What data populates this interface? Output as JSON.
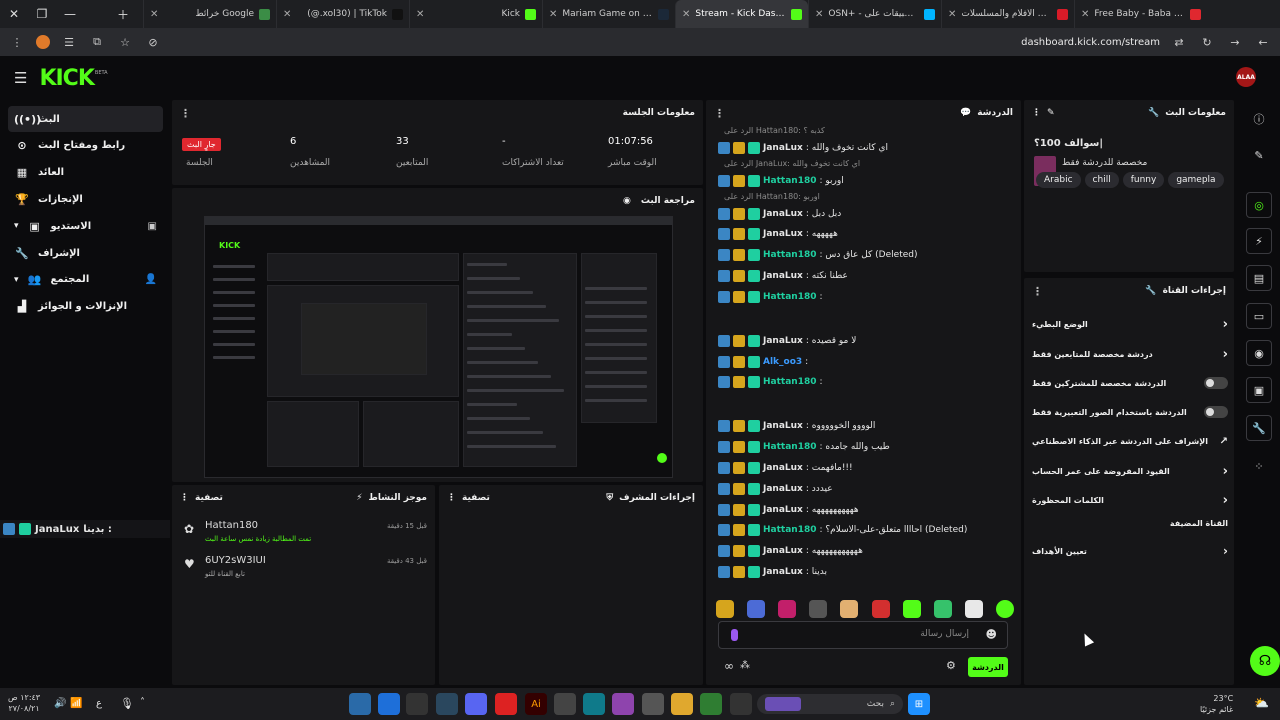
{
  "browser": {
    "tabs": [
      {
        "title": "خرائط Google",
        "color": "#3b8d46"
      },
      {
        "title": "(@.xol30) | TikTok",
        "color": "#111111"
      },
      {
        "title": "Kick",
        "color": "#53fc18"
      },
      {
        "title": "Mariam Game on Steam",
        "color": "#1b2838"
      },
      {
        "title": "Stream - Kick Dashbo",
        "color": "#53fc18",
        "active": true
      },
      {
        "title": "OSN+ - التطبيقات على",
        "color": "#00b4ff"
      },
      {
        "title": "شاهد أفضل الأفلام والمسلسلات",
        "color": "#d81b28"
      },
      {
        "title": "Free Baby - Baba Fein (M",
        "color": "#e0282f"
      }
    ],
    "url": "dashboard.kick.com/stream"
  },
  "header": {
    "logo": "KICK",
    "beta": "BETA",
    "avatar_text": "ALAA"
  },
  "leftnav": {
    "items": [
      {
        "label": "البث",
        "icon": "broadcast-icon"
      },
      {
        "label": "رابط ومفتاح البث",
        "icon": "link-icon"
      },
      {
        "label": "العائد",
        "icon": "chart-icon"
      },
      {
        "label": "الإنجازات",
        "icon": "trophy-icon"
      },
      {
        "label": "الاستديو",
        "icon": "studio-icon"
      },
      {
        "label": "الإشراف",
        "icon": "wrench-icon"
      },
      {
        "label": "المجتمع",
        "icon": "community-icon"
      },
      {
        "label": "الإنزالات و الجوائز",
        "icon": "drops-icon"
      }
    ]
  },
  "viewer_join": {
    "prefix": "بدينا : ",
    "user": "JanaLux"
  },
  "session": {
    "title": "معلومات الجلسة",
    "live_badge": "جارٍ البث",
    "session_label": "الجلسة",
    "stats": [
      {
        "value": "6",
        "label": "المشاهدين"
      },
      {
        "value": "33",
        "label": "المتابعين"
      },
      {
        "value": "-",
        "label": "تعداد الاشتراكات"
      },
      {
        "value": "01:07:56",
        "label": "الوقت مباشر"
      }
    ]
  },
  "preview": {
    "title": "مراجعة البث"
  },
  "activity": {
    "title": "موجز النشاط",
    "filter": "تصفية",
    "events": [
      {
        "user": "Hattan180",
        "text": "تمت المطالبة زيادة نمس ساعة البث",
        "time": "قبل 15 دقيقة",
        "icon": "gift-icon"
      },
      {
        "user": "6UY2sW3IUI",
        "text": "تابع القناة للتو",
        "time": "قبل 43 دقيقة",
        "icon": "heart-icon"
      }
    ]
  },
  "mod_actions": {
    "title": "إجراءات المشرف",
    "filter": "تصفية"
  },
  "chat": {
    "title": "الدردشة",
    "lines": [
      {
        "reply": "الرد على Hattan180: كذبه ؟",
        "user": "JanaLux",
        "color": "#e6e6e6",
        "text": ": اي كانت تخوف والله"
      },
      {
        "reply": "الرد على JanaLux: اي كانت تخوف والله",
        "user": "Hattan180",
        "color": "#1fcfa0",
        "text": ": اوربو"
      },
      {
        "reply": "الرد على Hattan180: اوربو",
        "user": "JanaLux",
        "color": "#e6e6e6",
        "text": ": دبل دبل"
      },
      {
        "user": "JanaLux",
        "color": "#e6e6e6",
        "text": ": هههههه"
      },
      {
        "user": "Hattan180",
        "color": "#1fcfa0",
        "text": ": كل عاق دس (Deleted)"
      },
      {
        "user": "JanaLux",
        "color": "#e6e6e6",
        "text": ": عطنا نكته"
      },
      {
        "user": "Hattan180",
        "color": "#1fcfa0",
        "text": ":"
      },
      {
        "user": "JanaLux",
        "color": "#e6e6e6",
        "text": ": لا مو قصيده"
      },
      {
        "user": "Alk_oo3",
        "color": "#3b9bff",
        "text": ":"
      },
      {
        "user": "Hattan180",
        "color": "#1fcfa0",
        "text": ":"
      },
      {
        "user": "JanaLux",
        "color": "#e6e6e6",
        "text": ": الوووو الخوووووه"
      },
      {
        "user": "Hattan180",
        "color": "#1fcfa0",
        "text": ": طيب والله جامده"
      },
      {
        "user": "JanaLux",
        "color": "#e6e6e6",
        "text": ": مافهمت!!!"
      },
      {
        "user": "JanaLux",
        "color": "#e6e6e6",
        "text": ": عيددد"
      },
      {
        "user": "JanaLux",
        "color": "#e6e6e6",
        "text": ": ههههههههههه"
      },
      {
        "user": "Hattan180",
        "color": "#1fcfa0",
        "text": ": احاااا متعلق-على-الاسلام؟ (Deleted)"
      },
      {
        "user": "JanaLux",
        "color": "#e6e6e6",
        "text": ": هههههههههههه"
      },
      {
        "user": "JanaLux",
        "color": "#e6e6e6",
        "text": ": بدينا"
      }
    ],
    "input_placeholder": "إرسال رسالة",
    "send_label": "الدردشة"
  },
  "stream_info": {
    "title": "معلومات البث",
    "stream_title": "سوالف 100؟|",
    "category": "مخصصة للدردشة فقط",
    "tags": [
      "Arabic",
      "chill",
      "funny",
      "gamepla"
    ]
  },
  "channel_actions": {
    "title": "إجراءات القناة",
    "rows": [
      {
        "label": "الوضع البطيء",
        "type": "chevron"
      },
      {
        "label": "دردشة مخصصة للمتابعين فقط",
        "type": "chevron"
      },
      {
        "label": "الدردشة مخصصة للمشتركين فقط",
        "type": "toggle"
      },
      {
        "label": "الدردشة باستخدام الصور التعبيرية فقط",
        "type": "toggle"
      },
      {
        "label": "الإشراف على الدردشة عبر الذكاء الاصطناعي",
        "type": "external"
      },
      {
        "label": "القيود المفروضة على عمر الحساب",
        "type": "chevron"
      },
      {
        "label": "الكلمات المحظورة",
        "type": "chevron"
      }
    ],
    "section": "القناة المضيفة",
    "goals_label": "تعيين الأهداف"
  },
  "taskbar": {
    "search_placeholder": "بحث",
    "time": "١٢:٤٣ ص",
    "date": "٢٧/٠٨/٢١",
    "weather_temp": "23°C",
    "weather_desc": "غائم جزئيًا",
    "lang": "ع"
  }
}
